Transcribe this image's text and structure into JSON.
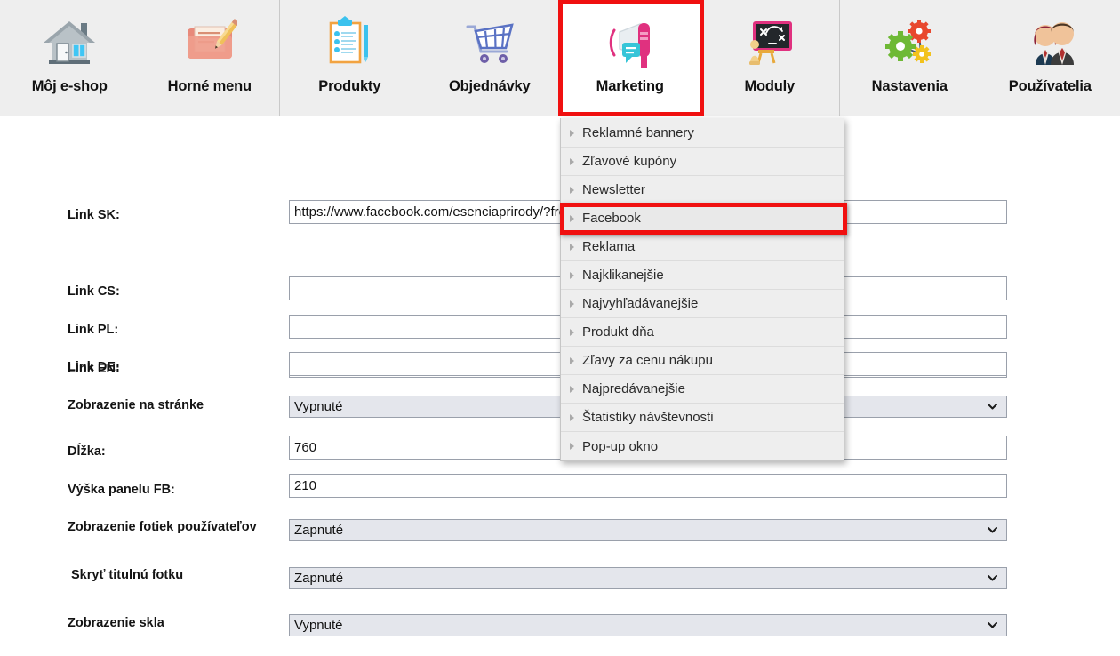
{
  "topnav": {
    "items": [
      {
        "label": "Môj e-shop",
        "icon": "house-icon",
        "active": false
      },
      {
        "label": "Horné menu",
        "icon": "folder-pencil-icon",
        "active": false
      },
      {
        "label": "Produkty",
        "icon": "clipboard-icon",
        "active": false
      },
      {
        "label": "Objednávky",
        "icon": "shopping-cart-icon",
        "active": false
      },
      {
        "label": "Marketing",
        "icon": "megaphone-icon",
        "active": true
      },
      {
        "label": "Moduly",
        "icon": "chalkboard-icon",
        "active": false
      },
      {
        "label": "Nastavenia",
        "icon": "gears-icon",
        "active": false
      },
      {
        "label": "Používatelia",
        "icon": "users-icon",
        "active": false
      }
    ]
  },
  "dropdown": {
    "items": [
      {
        "label": "Reklamné bannery",
        "selected": false
      },
      {
        "label": "Zľavové kupóny",
        "selected": false
      },
      {
        "label": "Newsletter",
        "selected": false
      },
      {
        "label": "Facebook",
        "selected": true
      },
      {
        "label": "Reklama",
        "selected": false
      },
      {
        "label": "Najklikanejšie",
        "selected": false
      },
      {
        "label": "Najvyhľadávanejšie",
        "selected": false
      },
      {
        "label": "Produkt dňa",
        "selected": false
      },
      {
        "label": "Zľavy za cenu nákupu",
        "selected": false
      },
      {
        "label": "Najpredávanejšie",
        "selected": false
      },
      {
        "label": "Štatistiky návštevnosti",
        "selected": false
      },
      {
        "label": "Pop-up okno",
        "selected": false
      }
    ]
  },
  "form": {
    "fields": [
      {
        "label": "Link SK:",
        "type": "text",
        "value": "https://www.facebook.com/esenciaprirody/?fref=page_invite&ref=notif"
      },
      {
        "label": "Link EN:",
        "type": "text",
        "value": ""
      },
      {
        "label": "Link CS:",
        "type": "text",
        "value": ""
      },
      {
        "label": "Link PL:",
        "type": "text",
        "value": ""
      },
      {
        "label": "Link DE:",
        "type": "text",
        "value": ""
      },
      {
        "label": "Zobrazenie na stránke",
        "type": "select",
        "value": "Vypnuté"
      },
      {
        "label": "Dĺžka:",
        "type": "text",
        "value": "760"
      },
      {
        "label": "Výška panelu FB:",
        "type": "text",
        "value": "210"
      },
      {
        "label": "Zobrazenie fotiek používateľov",
        "type": "select",
        "value": "Zapnuté"
      },
      {
        "label": "Skryť titulnú fotku",
        "type": "select",
        "value": "Zapnuté"
      },
      {
        "label": "Zobrazenie skla",
        "type": "select",
        "value": "Vypnuté"
      }
    ],
    "select_options": [
      "Zapnuté",
      "Vypnuté"
    ]
  },
  "colors": {
    "highlight": "#f01010",
    "nav_background": "#eeeeee",
    "menu_background": "#eeeeee"
  }
}
